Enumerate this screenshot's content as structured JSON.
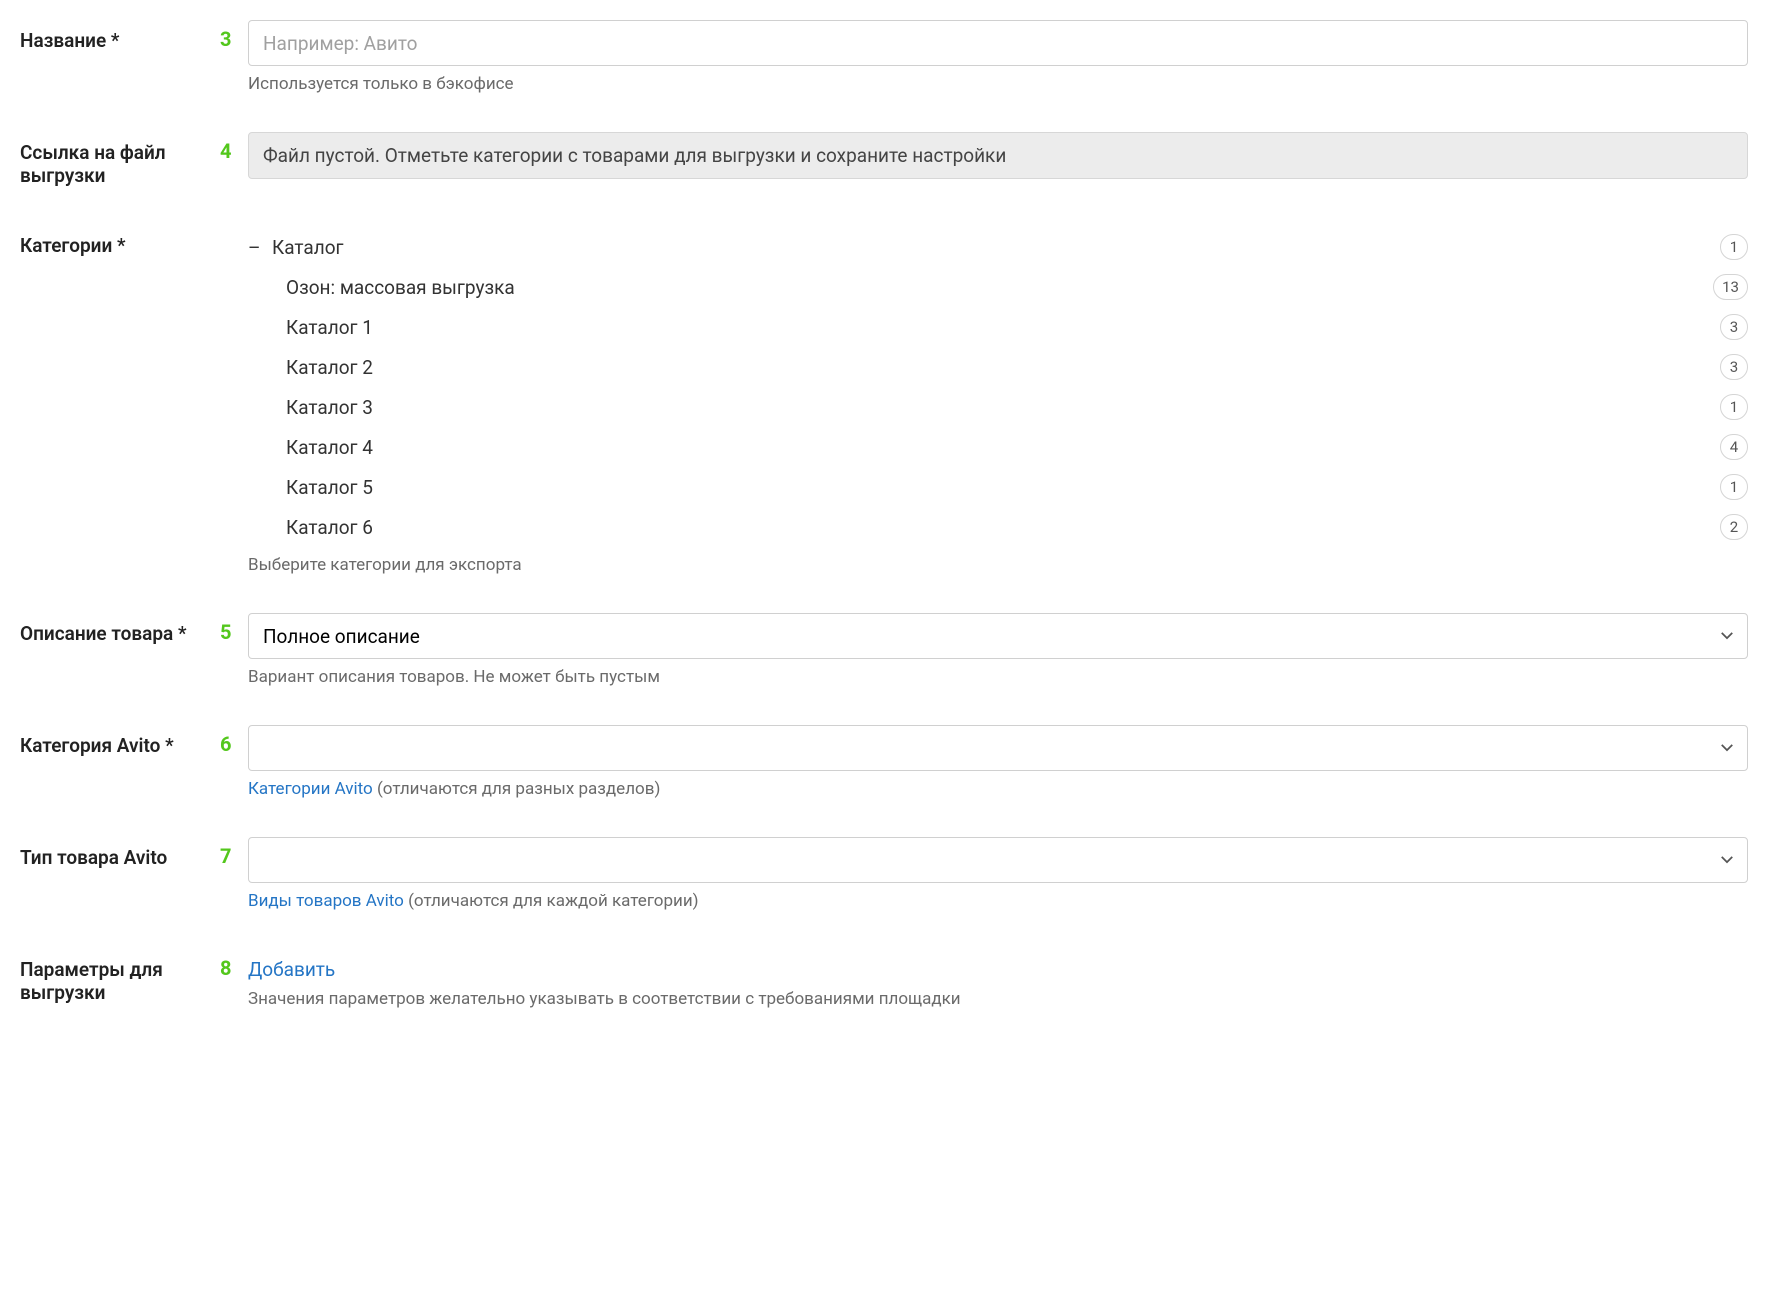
{
  "name": {
    "label": "Название *",
    "marker": "3",
    "placeholder": "Например: Авито",
    "hint": "Используется только в бэкофисе"
  },
  "export_link": {
    "label": "Ссылка на файл выгрузки",
    "marker": "4",
    "message": "Файл пустой. Отметьте категории с товарами для выгрузки и сохраните настройки"
  },
  "categories": {
    "label": "Категории *",
    "root": {
      "name": "Каталог",
      "count": "1"
    },
    "children": [
      {
        "name": "Озон: массовая выгрузка",
        "count": "13"
      },
      {
        "name": "Каталог 1",
        "count": "3"
      },
      {
        "name": "Каталог 2",
        "count": "3"
      },
      {
        "name": "Каталог 3",
        "count": "1"
      },
      {
        "name": "Каталог 4",
        "count": "4"
      },
      {
        "name": "Каталог 5",
        "count": "1"
      },
      {
        "name": "Каталог 6",
        "count": "2"
      }
    ],
    "hint": "Выберите категории для экспорта"
  },
  "description": {
    "label": "Описание товара *",
    "marker": "5",
    "selected": "Полное описание",
    "hint": "Вариант описания товаров. Не может быть пустым"
  },
  "avito_category": {
    "label": "Категория Avito *",
    "marker": "6",
    "hint_link": "Категории Avito",
    "hint_rest": " (отличаются для разных разделов)"
  },
  "avito_type": {
    "label": "Тип товара Avito",
    "marker": "7",
    "hint_link": "Виды товаров Avito",
    "hint_rest": " (отличаются для каждой категории)"
  },
  "export_params": {
    "label": "Параметры для выгрузки",
    "marker": "8",
    "add": "Добавить",
    "hint": "Значения параметров желательно указывать в соответствии с требованиями площадки"
  }
}
